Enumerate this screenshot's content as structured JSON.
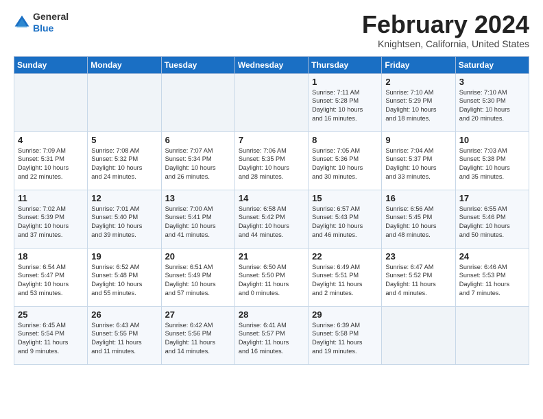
{
  "header": {
    "logo_general": "General",
    "logo_blue": "Blue",
    "title": "February 2024",
    "subtitle": "Knightsen, California, United States"
  },
  "weekdays": [
    "Sunday",
    "Monday",
    "Tuesday",
    "Wednesday",
    "Thursday",
    "Friday",
    "Saturday"
  ],
  "weeks": [
    [
      {
        "day": "",
        "info": ""
      },
      {
        "day": "",
        "info": ""
      },
      {
        "day": "",
        "info": ""
      },
      {
        "day": "",
        "info": ""
      },
      {
        "day": "1",
        "info": "Sunrise: 7:11 AM\nSunset: 5:28 PM\nDaylight: 10 hours\nand 16 minutes."
      },
      {
        "day": "2",
        "info": "Sunrise: 7:10 AM\nSunset: 5:29 PM\nDaylight: 10 hours\nand 18 minutes."
      },
      {
        "day": "3",
        "info": "Sunrise: 7:10 AM\nSunset: 5:30 PM\nDaylight: 10 hours\nand 20 minutes."
      }
    ],
    [
      {
        "day": "4",
        "info": "Sunrise: 7:09 AM\nSunset: 5:31 PM\nDaylight: 10 hours\nand 22 minutes."
      },
      {
        "day": "5",
        "info": "Sunrise: 7:08 AM\nSunset: 5:32 PM\nDaylight: 10 hours\nand 24 minutes."
      },
      {
        "day": "6",
        "info": "Sunrise: 7:07 AM\nSunset: 5:34 PM\nDaylight: 10 hours\nand 26 minutes."
      },
      {
        "day": "7",
        "info": "Sunrise: 7:06 AM\nSunset: 5:35 PM\nDaylight: 10 hours\nand 28 minutes."
      },
      {
        "day": "8",
        "info": "Sunrise: 7:05 AM\nSunset: 5:36 PM\nDaylight: 10 hours\nand 30 minutes."
      },
      {
        "day": "9",
        "info": "Sunrise: 7:04 AM\nSunset: 5:37 PM\nDaylight: 10 hours\nand 33 minutes."
      },
      {
        "day": "10",
        "info": "Sunrise: 7:03 AM\nSunset: 5:38 PM\nDaylight: 10 hours\nand 35 minutes."
      }
    ],
    [
      {
        "day": "11",
        "info": "Sunrise: 7:02 AM\nSunset: 5:39 PM\nDaylight: 10 hours\nand 37 minutes."
      },
      {
        "day": "12",
        "info": "Sunrise: 7:01 AM\nSunset: 5:40 PM\nDaylight: 10 hours\nand 39 minutes."
      },
      {
        "day": "13",
        "info": "Sunrise: 7:00 AM\nSunset: 5:41 PM\nDaylight: 10 hours\nand 41 minutes."
      },
      {
        "day": "14",
        "info": "Sunrise: 6:58 AM\nSunset: 5:42 PM\nDaylight: 10 hours\nand 44 minutes."
      },
      {
        "day": "15",
        "info": "Sunrise: 6:57 AM\nSunset: 5:43 PM\nDaylight: 10 hours\nand 46 minutes."
      },
      {
        "day": "16",
        "info": "Sunrise: 6:56 AM\nSunset: 5:45 PM\nDaylight: 10 hours\nand 48 minutes."
      },
      {
        "day": "17",
        "info": "Sunrise: 6:55 AM\nSunset: 5:46 PM\nDaylight: 10 hours\nand 50 minutes."
      }
    ],
    [
      {
        "day": "18",
        "info": "Sunrise: 6:54 AM\nSunset: 5:47 PM\nDaylight: 10 hours\nand 53 minutes."
      },
      {
        "day": "19",
        "info": "Sunrise: 6:52 AM\nSunset: 5:48 PM\nDaylight: 10 hours\nand 55 minutes."
      },
      {
        "day": "20",
        "info": "Sunrise: 6:51 AM\nSunset: 5:49 PM\nDaylight: 10 hours\nand 57 minutes."
      },
      {
        "day": "21",
        "info": "Sunrise: 6:50 AM\nSunset: 5:50 PM\nDaylight: 11 hours\nand 0 minutes."
      },
      {
        "day": "22",
        "info": "Sunrise: 6:49 AM\nSunset: 5:51 PM\nDaylight: 11 hours\nand 2 minutes."
      },
      {
        "day": "23",
        "info": "Sunrise: 6:47 AM\nSunset: 5:52 PM\nDaylight: 11 hours\nand 4 minutes."
      },
      {
        "day": "24",
        "info": "Sunrise: 6:46 AM\nSunset: 5:53 PM\nDaylight: 11 hours\nand 7 minutes."
      }
    ],
    [
      {
        "day": "25",
        "info": "Sunrise: 6:45 AM\nSunset: 5:54 PM\nDaylight: 11 hours\nand 9 minutes."
      },
      {
        "day": "26",
        "info": "Sunrise: 6:43 AM\nSunset: 5:55 PM\nDaylight: 11 hours\nand 11 minutes."
      },
      {
        "day": "27",
        "info": "Sunrise: 6:42 AM\nSunset: 5:56 PM\nDaylight: 11 hours\nand 14 minutes."
      },
      {
        "day": "28",
        "info": "Sunrise: 6:41 AM\nSunset: 5:57 PM\nDaylight: 11 hours\nand 16 minutes."
      },
      {
        "day": "29",
        "info": "Sunrise: 6:39 AM\nSunset: 5:58 PM\nDaylight: 11 hours\nand 19 minutes."
      },
      {
        "day": "",
        "info": ""
      },
      {
        "day": "",
        "info": ""
      }
    ]
  ]
}
